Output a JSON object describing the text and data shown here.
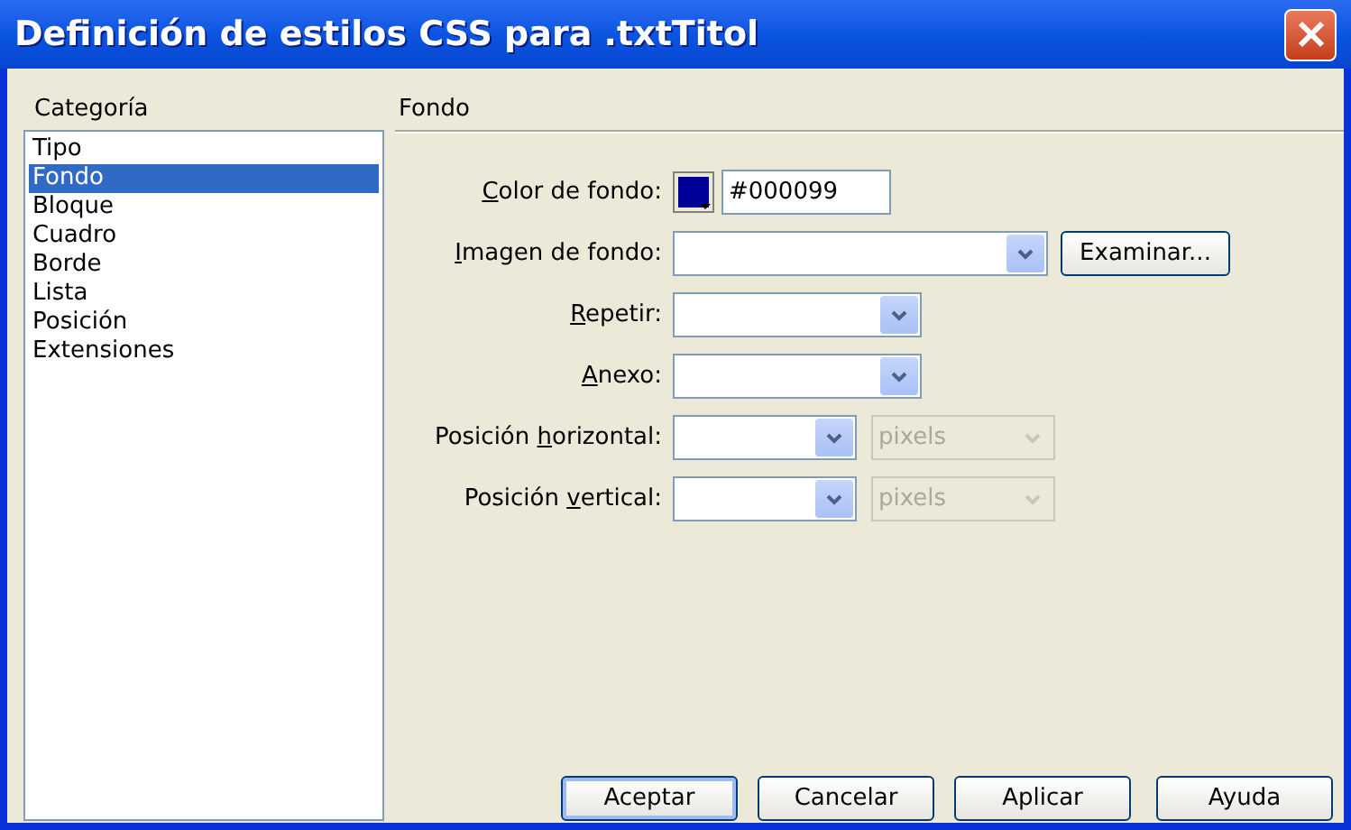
{
  "window": {
    "title": "Definición de estilos CSS para .txtTitol"
  },
  "sidebar": {
    "heading": "Categoría",
    "items": [
      {
        "label": "Tipo",
        "selected": false
      },
      {
        "label": "Fondo",
        "selected": true
      },
      {
        "label": "Bloque",
        "selected": false
      },
      {
        "label": "Cuadro",
        "selected": false
      },
      {
        "label": "Borde",
        "selected": false
      },
      {
        "label": "Lista",
        "selected": false
      },
      {
        "label": "Posición",
        "selected": false
      },
      {
        "label": "Extensiones",
        "selected": false
      }
    ]
  },
  "panel": {
    "heading": "Fondo",
    "rows": [
      {
        "kind": "color",
        "label": {
          "key": "C",
          "post": "olor de fondo:"
        },
        "color": "#000099",
        "value": "#000099"
      },
      {
        "kind": "combo_button",
        "label": {
          "key": "I",
          "post": "magen de fondo:"
        },
        "button": "Examinar..."
      },
      {
        "kind": "select",
        "label": {
          "key": "R",
          "post": "epetir:"
        }
      },
      {
        "kind": "select",
        "label": {
          "key": "A",
          "post": "nexo:"
        }
      },
      {
        "kind": "select_unit",
        "label": {
          "pre": "Posición ",
          "key": "h",
          "post": "orizontal:"
        },
        "unit": "pixels",
        "unit_disabled": true
      },
      {
        "kind": "select_unit",
        "label": {
          "pre": "Posición ",
          "key": "v",
          "post": "ertical:"
        },
        "unit": "pixels",
        "unit_disabled": true
      }
    ]
  },
  "buttons": [
    "Aceptar",
    "Cancelar",
    "Aplicar",
    "Ayuda"
  ]
}
